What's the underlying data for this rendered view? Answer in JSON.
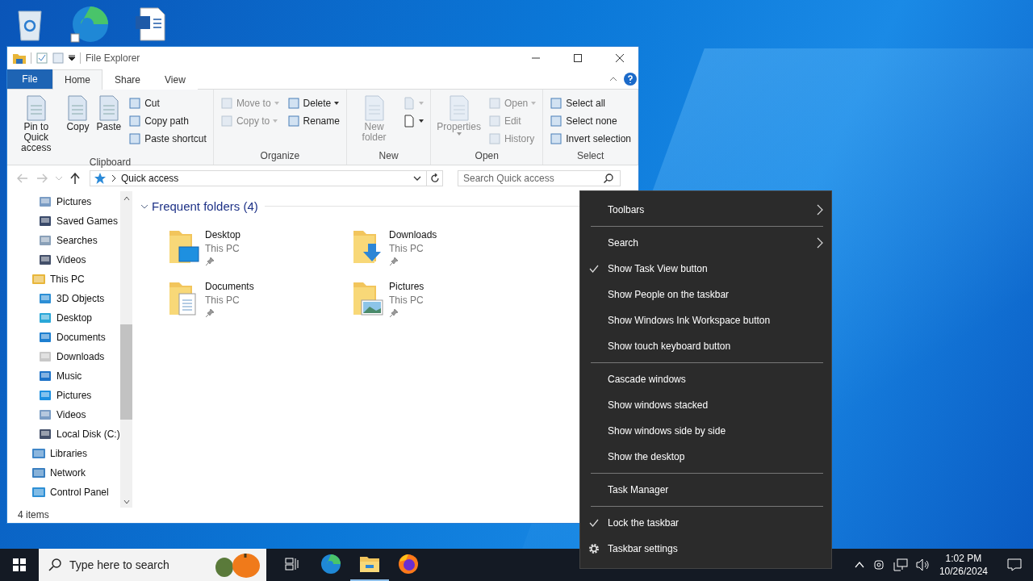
{
  "window": {
    "title": "File Explorer"
  },
  "ribbon_tabs": [
    {
      "label": "File",
      "kind": "file",
      "selected": false
    },
    {
      "label": "Home",
      "kind": "tab",
      "selected": true
    },
    {
      "label": "Share",
      "kind": "tab",
      "selected": false
    },
    {
      "label": "View",
      "kind": "tab",
      "selected": false
    }
  ],
  "ribbon_groups": [
    {
      "name": "Clipboard",
      "columns": [
        [
          {
            "kind": "large",
            "label": "Pin to Quick access",
            "disabled": false
          }
        ],
        [
          {
            "kind": "large",
            "label": "Copy",
            "disabled": false
          }
        ],
        [
          {
            "kind": "large",
            "label": "Paste",
            "disabled": false
          }
        ],
        [
          {
            "kind": "small",
            "label": "Cut",
            "disabled": false
          },
          {
            "kind": "small",
            "label": "Copy path",
            "disabled": false
          },
          {
            "kind": "small",
            "label": "Paste shortcut",
            "disabled": false
          }
        ]
      ]
    },
    {
      "name": "Organize",
      "columns": [
        [
          {
            "kind": "small",
            "label": "Move to",
            "dropdown": true,
            "disabled": true
          },
          {
            "kind": "small",
            "label": "Copy to",
            "dropdown": true,
            "disabled": true
          }
        ],
        [
          {
            "kind": "small",
            "label": "Delete",
            "dropdown": true,
            "disabled": false
          },
          {
            "kind": "small",
            "label": "Rename",
            "disabled": false
          }
        ]
      ]
    },
    {
      "name": "New",
      "columns": [
        [
          {
            "kind": "large",
            "label": "New folder",
            "disabled": true
          }
        ],
        [
          {
            "kind": "icon",
            "dropdown": true,
            "disabled": true
          },
          {
            "kind": "icon",
            "dropdown": true,
            "disabled": false
          }
        ]
      ]
    },
    {
      "name": "Open",
      "columns": [
        [
          {
            "kind": "large",
            "label": "Properties",
            "dropdown": true,
            "disabled": true
          }
        ],
        [
          {
            "kind": "small",
            "label": "Open",
            "dropdown": true,
            "disabled": true
          },
          {
            "kind": "small",
            "label": "Edit",
            "disabled": true
          },
          {
            "kind": "small",
            "label": "History",
            "disabled": true
          }
        ]
      ]
    },
    {
      "name": "Select",
      "columns": [
        [
          {
            "kind": "small",
            "label": "Select all",
            "disabled": false
          },
          {
            "kind": "small",
            "label": "Select none",
            "disabled": false
          },
          {
            "kind": "small",
            "label": "Invert selection",
            "disabled": false
          }
        ]
      ]
    }
  ],
  "address": {
    "value": "Quick access"
  },
  "search": {
    "placeholder": "Search Quick access"
  },
  "tree": [
    {
      "children": [
        {
          "label": "Pictures"
        },
        {
          "label": "Saved Games"
        },
        {
          "label": "Searches"
        },
        {
          "label": "Videos"
        }
      ]
    },
    {
      "label": "This PC",
      "children": [
        {
          "label": "3D Objects"
        },
        {
          "label": "Desktop"
        },
        {
          "label": "Documents"
        },
        {
          "label": "Downloads"
        },
        {
          "label": "Music"
        },
        {
          "label": "Pictures"
        },
        {
          "label": "Videos"
        },
        {
          "label": "Local Disk (C:)"
        }
      ]
    },
    {
      "label": "Libraries"
    },
    {
      "label": "Network"
    },
    {
      "label": "Control Panel"
    }
  ],
  "section": {
    "title": "Frequent folders (4)",
    "expanded": true
  },
  "folders": [
    {
      "name": "Desktop",
      "location": "This PC",
      "pinned": true
    },
    {
      "name": "Downloads",
      "location": "This PC",
      "pinned": true
    },
    {
      "name": "Documents",
      "location": "This PC",
      "pinned": true
    },
    {
      "name": "Pictures",
      "location": "This PC",
      "pinned": true
    }
  ],
  "status_bar": {
    "items": "4 items"
  },
  "context_menu": [
    {
      "kind": "item",
      "label": "Toolbars",
      "submenu": true,
      "checked": false
    },
    {
      "kind": "separator"
    },
    {
      "kind": "item",
      "label": "Search",
      "submenu": true,
      "checked": false
    },
    {
      "kind": "item",
      "label": "Show Task View button",
      "checked": true
    },
    {
      "kind": "item",
      "label": "Show People on the taskbar",
      "checked": false
    },
    {
      "kind": "item",
      "label": "Show Windows Ink Workspace button",
      "checked": false
    },
    {
      "kind": "item",
      "label": "Show touch keyboard button",
      "checked": false
    },
    {
      "kind": "separator"
    },
    {
      "kind": "item",
      "label": "Cascade windows",
      "checked": false
    },
    {
      "kind": "item",
      "label": "Show windows stacked",
      "checked": false
    },
    {
      "kind": "item",
      "label": "Show windows side by side",
      "checked": false
    },
    {
      "kind": "item",
      "label": "Show the desktop",
      "checked": false
    },
    {
      "kind": "separator"
    },
    {
      "kind": "item",
      "label": "Task Manager",
      "checked": false
    },
    {
      "kind": "separator"
    },
    {
      "kind": "item",
      "label": "Lock the taskbar",
      "checked": true
    },
    {
      "kind": "settings",
      "label": "Taskbar settings"
    }
  ],
  "taskbar": {
    "search_placeholder": "Type here to search",
    "apps": [
      {
        "kind": "task-view",
        "running": false
      },
      {
        "kind": "edge",
        "running": false
      },
      {
        "kind": "explorer",
        "running": true
      },
      {
        "kind": "firefox",
        "running": false
      }
    ],
    "time": "1:02 PM",
    "date": "10/26/2024"
  }
}
